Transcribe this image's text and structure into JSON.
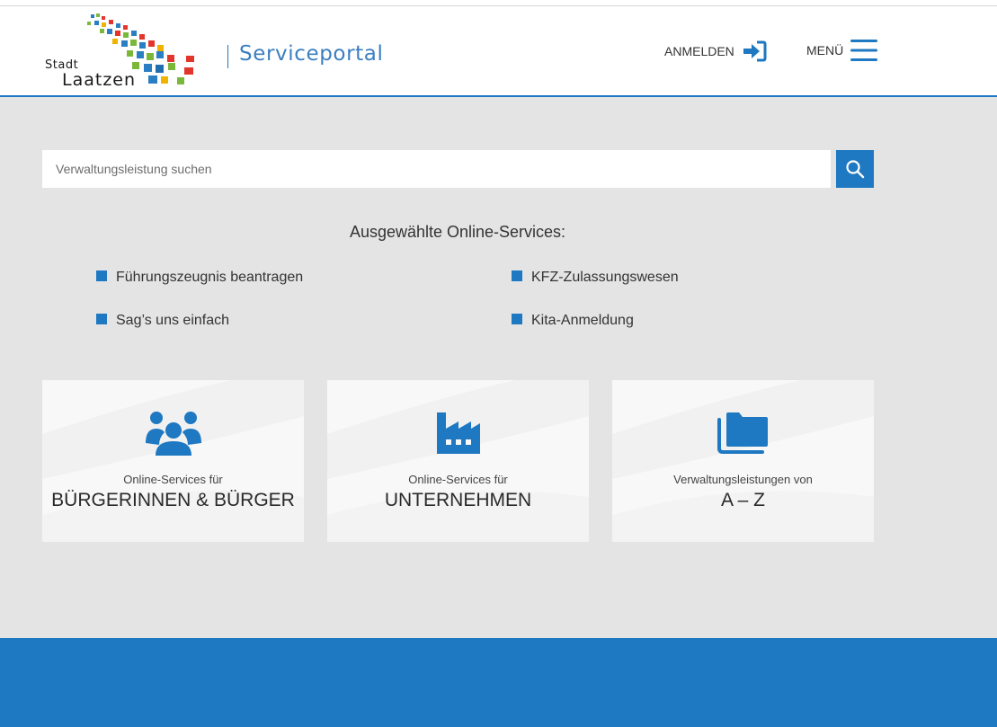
{
  "header": {
    "logo_text_line1": "Stadt",
    "logo_text_line2": "Laatzen",
    "portal_title": "Serviceportal",
    "login_label": "ANMELDEN",
    "menu_label": "MENÜ"
  },
  "search": {
    "placeholder": "Verwaltungsleistung suchen"
  },
  "selected": {
    "heading": "Ausgewählte Online-Services:",
    "items": [
      {
        "label": "Führungszeugnis beantragen"
      },
      {
        "label": "KFZ-Zulassungswesen"
      },
      {
        "label": "Sag’s uns einfach"
      },
      {
        "label": "Kita-Anmeldung"
      }
    ]
  },
  "tiles": [
    {
      "sub": "Online-Services für",
      "big": "BÜRGERINNEN & BÜRGER",
      "icon": "users-icon"
    },
    {
      "sub": "Online-Services für",
      "big": "UNTERNEHMEN",
      "icon": "factory-icon"
    },
    {
      "sub": "Verwaltungsleistungen von",
      "big": "A – Z",
      "icon": "folders-icon"
    }
  ],
  "colors": {
    "accent": "#1e78c2",
    "background": "#e4e4e4",
    "tile": "#f8f8f8"
  }
}
